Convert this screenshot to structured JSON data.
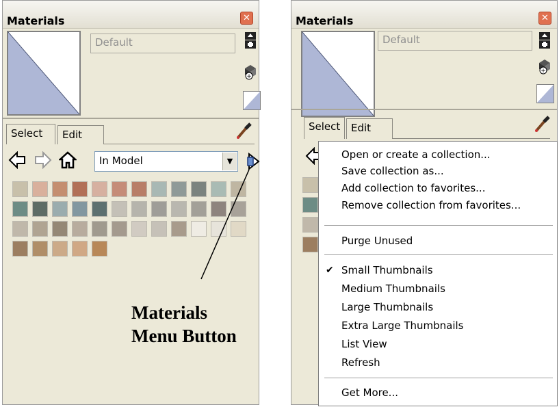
{
  "left_panel": {
    "title": "Materials",
    "material_name": "Default",
    "tabs": [
      "Select",
      "Edit"
    ],
    "collection": "In Model",
    "icons": [
      "back-arrow-icon",
      "forward-arrow-icon",
      "home-icon",
      "eyedropper-icon",
      "materials-menu-icon",
      "create-material-icon",
      "paint-bucket-icon",
      "default-swatch-icon"
    ],
    "swatches": [
      [
        "#c8c0aa",
        "#d9b09c",
        "#c48e70",
        "#b27057",
        "#d6b0a0",
        "#c58c78",
        "#b87e68",
        "#a8b8b4",
        "#8f9a98",
        "#7b837f",
        "#a9bbb4",
        "#bfb6a2"
      ],
      [
        "#6d8c85",
        "#5e6c66",
        "#9aacae",
        "#8297a0",
        "#5d7070",
        "#c4c0b7",
        "#b6b4ac",
        "#9f9d98",
        "#b9b7af",
        "#a3a098",
        "#8e847e",
        "#a8a299"
      ],
      [
        "#c0b8aa",
        "#b0a492",
        "#958876",
        "#b8ac9e",
        "#a09a8e",
        "#a49a8e",
        "#d1cbc2",
        "#c6c1b8",
        "#a89b8c",
        "#efece4",
        "#e7e4db",
        "#e1d9c6"
      ],
      [
        "#9c7e60",
        "#b08e68",
        "#ccaa88",
        "#d0a885",
        "#b88858"
      ]
    ]
  },
  "annotation": {
    "line1": "Materials",
    "line2": "Menu Button"
  },
  "right_panel": {
    "title": "Materials",
    "material_name": "Default",
    "tabs": [
      "Select",
      "Edit"
    ]
  },
  "context_menu": {
    "items": [
      {
        "label": "Open or create a collection...",
        "checked": false
      },
      {
        "label": "Save collection as...",
        "checked": false
      },
      {
        "label": "Add collection to favorites...",
        "checked": false
      },
      {
        "label": "Remove collection from favorites...",
        "checked": false
      },
      {
        "label": "Purge Unused",
        "checked": false
      },
      {
        "label": "Small Thumbnails",
        "checked": true
      },
      {
        "label": "Medium Thumbnails",
        "checked": false
      },
      {
        "label": "Large Thumbnails",
        "checked": false
      },
      {
        "label": "Extra Large Thumbnails",
        "checked": false
      },
      {
        "label": "List View",
        "checked": false
      },
      {
        "label": "Refresh",
        "checked": false
      },
      {
        "label": "Get More...",
        "checked": false
      }
    ],
    "checkmark": "✔"
  },
  "colors": {
    "panel_bg": "#ece9d8",
    "preview_blue": "#aeb7d6",
    "close_red": "#e0704f"
  }
}
